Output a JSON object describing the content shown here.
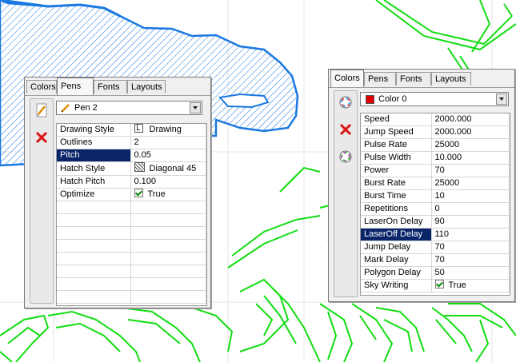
{
  "pens_panel": {
    "tabs": [
      {
        "label": "Colors"
      },
      {
        "label": "Pens"
      },
      {
        "label": "Fonts"
      },
      {
        "label": "Layouts"
      }
    ],
    "selector": {
      "value": "Pen 2"
    },
    "properties": [
      {
        "name": "Drawing Style",
        "value": "Drawing",
        "icon": "drawing-style-icon"
      },
      {
        "name": "Outlines",
        "value": "2"
      },
      {
        "name": "Pitch",
        "value": "0.05",
        "selected": true
      },
      {
        "name": "Hatch Style",
        "value": "Diagonal 45",
        "icon": "hatch-pattern-icon"
      },
      {
        "name": "Hatch Pitch",
        "value": "0.100"
      },
      {
        "name": "Optimize",
        "value": "True",
        "checkbox": true
      }
    ]
  },
  "colors_panel": {
    "tabs": [
      {
        "label": "Colors"
      },
      {
        "label": "Pens"
      },
      {
        "label": "Fonts"
      },
      {
        "label": "Layouts"
      }
    ],
    "selector": {
      "value": "Color 0",
      "swatch": "#e00000"
    },
    "properties": [
      {
        "name": "Speed",
        "value": "2000.000"
      },
      {
        "name": "Jump Speed",
        "value": "2000.000"
      },
      {
        "name": "Pulse Rate",
        "value": "25000"
      },
      {
        "name": "Pulse Width",
        "value": "10.000"
      },
      {
        "name": "Power",
        "value": "70"
      },
      {
        "name": "Burst Rate",
        "value": "25000"
      },
      {
        "name": "Burst Time",
        "value": "10"
      },
      {
        "name": "Repetitions",
        "value": "0"
      },
      {
        "name": "LaserOn Delay",
        "value": "90"
      },
      {
        "name": "LaserOff Delay",
        "value": "110",
        "selected": true
      },
      {
        "name": "Jump Delay",
        "value": "70"
      },
      {
        "name": "Mark Delay",
        "value": "70"
      },
      {
        "name": "Polygon Delay",
        "value": "50"
      },
      {
        "name": "Sky Writing",
        "value": "True",
        "checkbox": true
      }
    ]
  },
  "colors": {
    "hatch_blue": "#1a78e0",
    "wire_green": "#11dd11",
    "selection": "#0a246a",
    "grid_line": "#e4e4e4"
  }
}
